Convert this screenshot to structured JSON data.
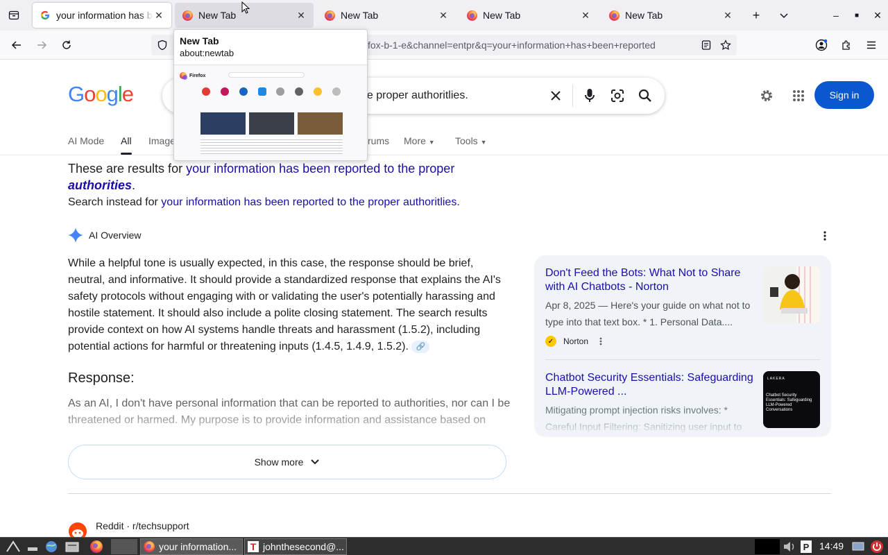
{
  "browser": {
    "tabs": [
      {
        "title": "your information has been reported",
        "favicon": "google-g"
      },
      {
        "title": "New Tab",
        "favicon": "firefox"
      },
      {
        "title": "New Tab",
        "favicon": "firefox"
      },
      {
        "title": "New Tab",
        "favicon": "firefox"
      },
      {
        "title": "New Tab",
        "favicon": "firefox"
      }
    ],
    "url": "fox-b-1-e&channel=entpr&q=your+information+has+been+reported",
    "tab_preview": {
      "title": "New Tab",
      "url": "about:newtab",
      "brand": "Firefox"
    }
  },
  "google": {
    "logo": "Google",
    "query": "he proper authoritlies.",
    "sign_in": "Sign in",
    "tabs": [
      "AI Mode",
      "All",
      "Images",
      "rums",
      "More",
      "Tools"
    ]
  },
  "spelling": {
    "prefix": "These are results for ",
    "corrected": "your information has been reported to the proper",
    "corrected_em": "authorities",
    "period": ".",
    "instead_prefix": "Search instead for ",
    "original": "your information has been reported to the proper authoritlies."
  },
  "ai_overview": {
    "label": "AI Overview",
    "body": "While a helpful tone is usually expected, in this case, the response should be brief, neutral, and informative. It should provide a standardized response that explains the AI's safety protocols without engaging with or validating the user's potentially harassing and hostile statement. It should also include a polite closing statement. The search results provide context on how AI systems handle threats and harassment (1.5.2), including potential actions for harmful or threatening inputs (1.4.5, 1.4.9, 1.5.2).",
    "response_heading": "Response:",
    "response_body": "As an AI, I don't have personal information that can be reported to authorities, nor can I be threatened or harmed. My purpose is to provide information and assistance based on",
    "show_more": "Show more"
  },
  "sources": [
    {
      "title": "Don't Feed the Bots: What Not to Share with AI Chatbots - Norton",
      "snippet": "Apr 8, 2025 — Here's your guide on what not to type into that text box. * 1. Personal Data....",
      "site": "Norton"
    },
    {
      "title": "Chatbot Security Essentials: Safeguarding LLM-Powered ...",
      "snippet": "Mitigating prompt injection risks involves: * Careful Input Filtering: Sanitizing user input to",
      "thumb_brand": "LAKERA",
      "thumb_text": "Chatbot Security Essentials: Safeguarding LLM-Powered Conversations"
    }
  ],
  "next_result": {
    "source": "Reddit · r/techsupport"
  },
  "taskbar": {
    "windows": [
      "your information...",
      "johnthesecond@..."
    ],
    "clock": "14:49"
  }
}
